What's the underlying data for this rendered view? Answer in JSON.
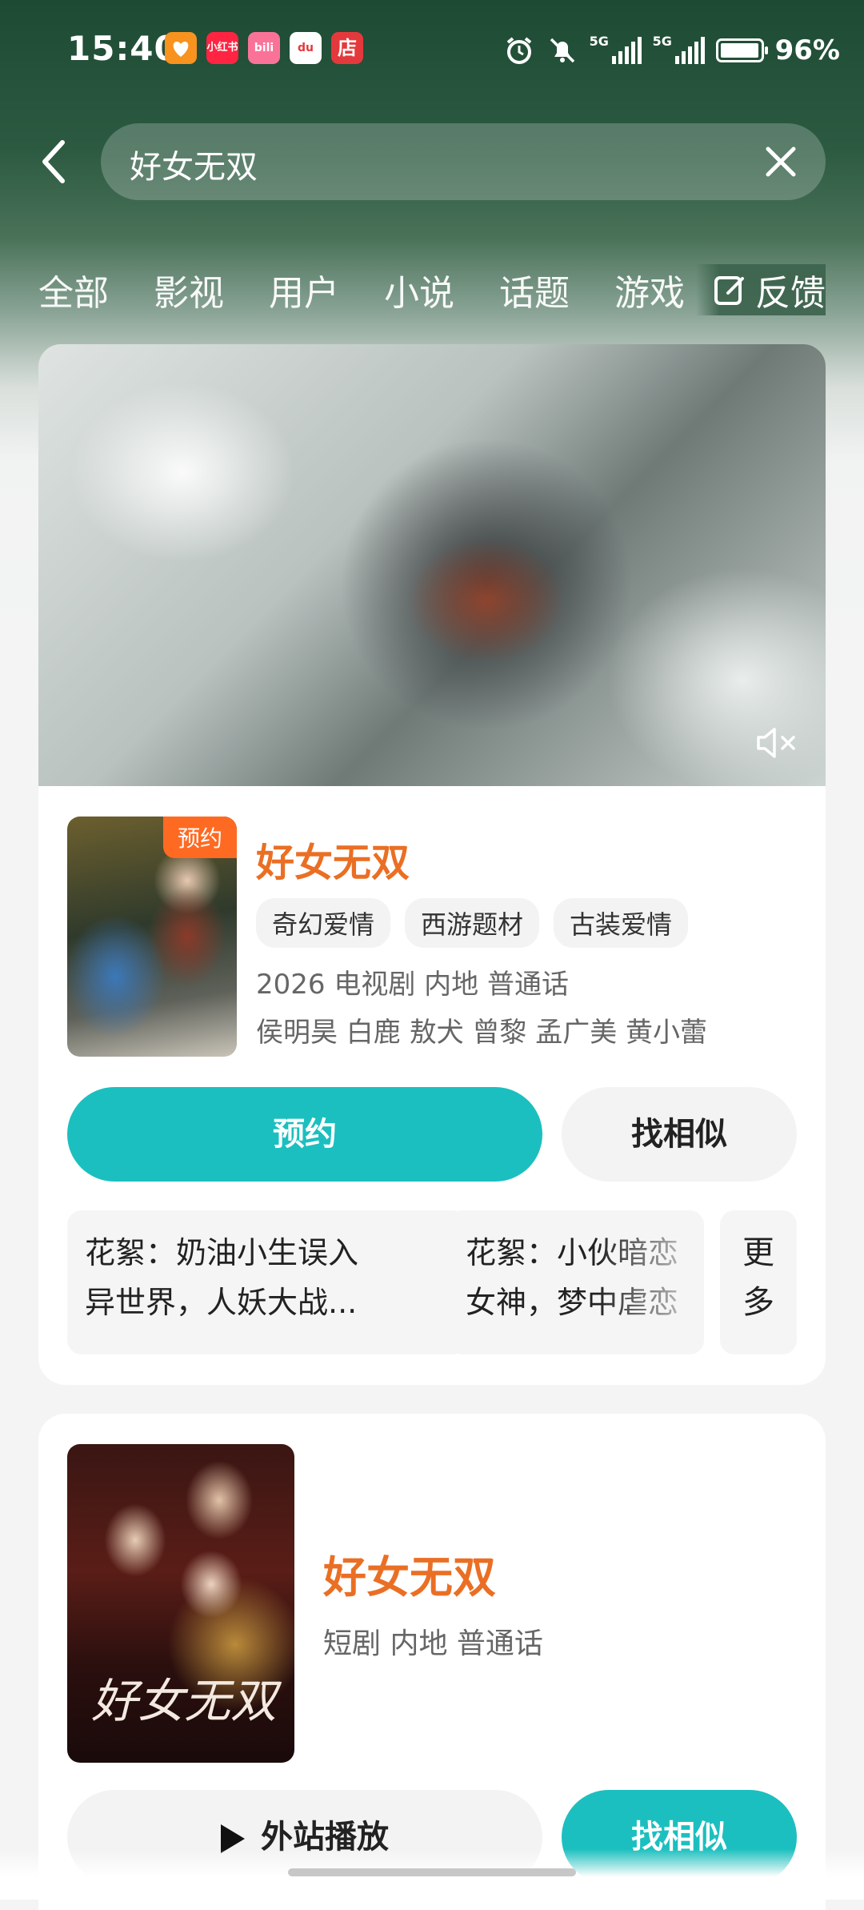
{
  "status_bar": {
    "time": "15:40",
    "app_icons": [
      {
        "name": "heart-app-icon",
        "color": "#f7931e",
        "label": ""
      },
      {
        "name": "xiaohongshu-icon",
        "color": "#ff2442",
        "label": "小红书"
      },
      {
        "name": "bilibili-icon",
        "color": "#fb7299",
        "label": "bili"
      },
      {
        "name": "dewu-icon",
        "color": "#ffffff",
        "label": "du"
      },
      {
        "name": "shop-icon",
        "color": "#e4393c",
        "label": "店"
      }
    ],
    "network_1": "5G",
    "network_2": "5G",
    "battery": "96%"
  },
  "search": {
    "query": "好女无双"
  },
  "tabs": [
    "全部",
    "影视",
    "用户",
    "小说",
    "话题",
    "游戏"
  ],
  "feedback_label": "反馈",
  "result1": {
    "badge": "预约",
    "title": "好女无双",
    "tags": [
      "奇幻爱情",
      "西游题材",
      "古装爱情"
    ],
    "meta": "2026 电视剧 内地 普通话",
    "cast": "侯明昊 白鹿 敖犬 曾黎 孟广美 黄小蕾",
    "primary_button": "预约",
    "secondary_button": "找相似",
    "clips": [
      {
        "line1": "花絮：奶油小生误入",
        "line2": "异世界，人妖大战..."
      },
      {
        "line1": "花絮：小伙暗恋",
        "line2": "女神，梦中虐恋"
      }
    ],
    "more_label_1": "更",
    "more_label_2": "多"
  },
  "result2": {
    "poster_text": "好女无双",
    "title": "好女无双",
    "meta": "短剧 内地 普通话",
    "play_button": "外站播放",
    "similar_button": "找相似"
  },
  "colors": {
    "accent": "#1cbfbf",
    "title_orange": "#ea6f24",
    "badge_orange": "#ff6a22"
  }
}
